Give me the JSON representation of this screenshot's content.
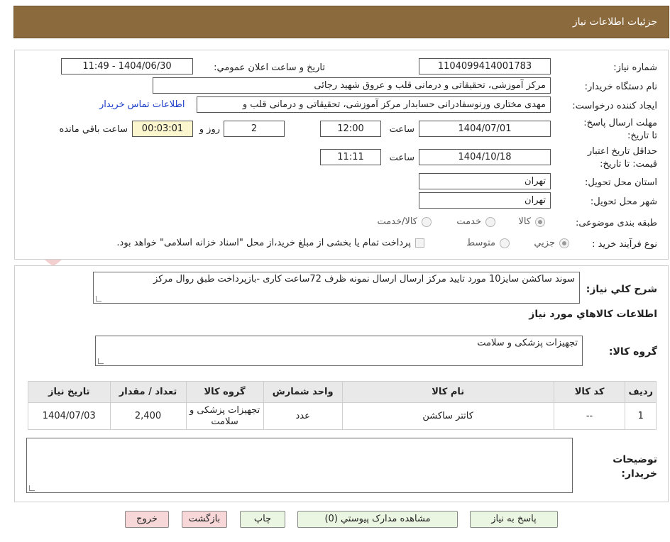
{
  "header": {
    "title": "جزئيات اطلاعات نياز"
  },
  "form": {
    "need_number_label": "شماره نياز:",
    "need_number": "1104099414001783",
    "announce_label": "تاريخ و ساعت اعلان عمومي:",
    "announce_value": "1404/06/30 - 11:49",
    "buyer_org_label": "نام دستگاه خريدار:",
    "buyer_org": "مرکز آموزشی، تحقیقاتی و درمانی قلب و عروق شهید رجائی",
    "requester_label": "ايجاد کننده درخواست:",
    "requester": "مهدی مختاری ورنوسفادرانی حسابدار مرکز آموزشی، تحقیقاتی و درمانی قلب و",
    "contact_link": "اطلاعات تماس خريدار",
    "reply_deadline_label": "مهلت ارسال پاسخ: تا تاریخ:",
    "reply_date": "1404/07/01",
    "time_label": "ساعت",
    "reply_time": "12:00",
    "days_value": "2",
    "days_label": "روز و",
    "remaining_time": "00:03:01",
    "remaining_label": "ساعت باقي مانده",
    "price_validity_label": "حداقل تاريخ اعتبار قيمت: تا تاريخ:",
    "price_date": "1404/10/18",
    "price_time": "11:11",
    "province_label": "استان محل تحويل:",
    "province": "تهران",
    "city_label": "شهر محل تحويل:",
    "city": "تهران",
    "category_label": "طبقه بندی موضوعی:",
    "category_options": [
      "کالا",
      "خدمت",
      "کالا/خدمت"
    ],
    "process_label": "نوع فرآيند خريد :",
    "process_options": [
      "جزيي",
      "متوسط"
    ],
    "payment_note": "پرداخت تمام يا بخشی از مبلغ خريد،از محل \"اسناد خزانه اسلامی\" خواهد بود."
  },
  "description": {
    "label": "شرح کلي نياز:",
    "text": "سوند ساکشن سایز10 مورد تایید مرکز ارسال ارسال نمونه ظرف 72ساعت کاری -بازپرداخت طبق روال مرکز"
  },
  "goods": {
    "section_title": "اطلاعات کالاهاي مورد نياز",
    "group_label": "گروه کالا:",
    "group_value": "تجهیزات پزشکی و سلامت",
    "table": {
      "headers": [
        "رديف",
        "کد کالا",
        "نام کالا",
        "واحد شمارش",
        "گروه کالا",
        "تعداد / مقدار",
        "تاريخ نياز"
      ],
      "rows": [
        [
          "1",
          "--",
          "کاتتر ساکشن",
          "عدد",
          "تجهیزات پزشکی و سلامت",
          "2,400",
          "1404/07/03"
        ]
      ]
    }
  },
  "buyer_notes": {
    "label": "توضيحات خريدار:",
    "text": ""
  },
  "buttons": {
    "reply": "پاسخ به نياز",
    "attachments": "مشاهده مدارک پيوستي (0)",
    "print": "چاپ",
    "back": "بازگشت",
    "exit": "خروج"
  },
  "watermark": {
    "text": "AriaTender.neT"
  }
}
